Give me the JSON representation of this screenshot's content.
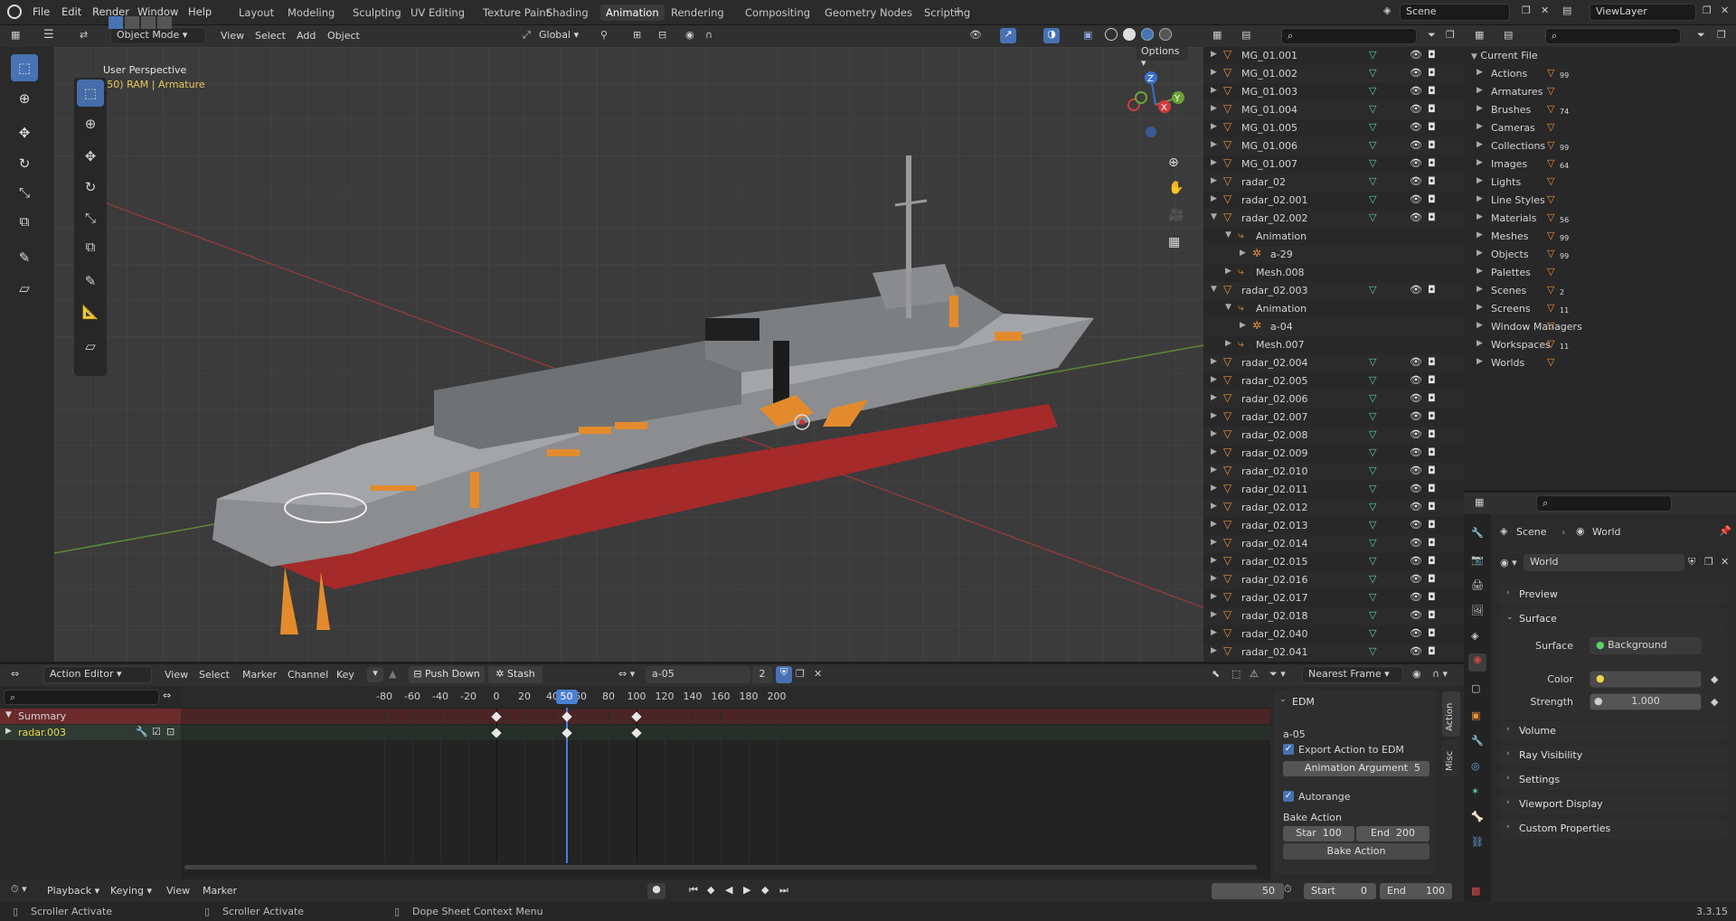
{
  "menu": {
    "file": "File",
    "edit": "Edit",
    "render": "Render",
    "window": "Window",
    "help": "Help"
  },
  "workspaces": [
    "Layout",
    "Modeling",
    "Sculpting",
    "UV Editing",
    "Texture Paint",
    "Shading",
    "Animation",
    "Rendering",
    "Compositing",
    "Geometry Nodes",
    "Scripting"
  ],
  "active_workspace": "Animation",
  "scene": {
    "name": "Scene",
    "view_layer": "ViewLayer"
  },
  "viewport": {
    "mode": "Object Mode",
    "view": "View",
    "select": "Select",
    "add": "Add",
    "object": "Object",
    "transform": "Global",
    "options": "Options",
    "title": "User Perspective",
    "subtitle": "(50) RAM | Armature"
  },
  "outliner": {
    "rows": [
      {
        "name": "MG_01.001",
        "indent": 0,
        "vis": true
      },
      {
        "name": "MG_01.002",
        "indent": 0,
        "vis": true
      },
      {
        "name": "MG_01.003",
        "indent": 0,
        "vis": true
      },
      {
        "name": "MG_01.004",
        "indent": 0,
        "vis": true
      },
      {
        "name": "MG_01.005",
        "indent": 0,
        "vis": true
      },
      {
        "name": "MG_01.006",
        "indent": 0,
        "vis": true
      },
      {
        "name": "MG_01.007",
        "indent": 0,
        "vis": true
      },
      {
        "name": "radar_02",
        "indent": 0,
        "vis": true
      },
      {
        "name": "radar_02.001",
        "indent": 0,
        "vis": true
      },
      {
        "name": "radar_02.002",
        "indent": 0,
        "vis": true,
        "open": true
      },
      {
        "name": "Animation",
        "indent": 1,
        "vis": false,
        "open": true
      },
      {
        "name": "a-29",
        "indent": 2,
        "vis": false
      },
      {
        "name": "Mesh.008",
        "indent": 1,
        "vis": false
      },
      {
        "name": "radar_02.003",
        "indent": 0,
        "vis": true,
        "open": true
      },
      {
        "name": "Animation",
        "indent": 1,
        "vis": false,
        "open": true
      },
      {
        "name": "a-04",
        "indent": 2,
        "vis": false
      },
      {
        "name": "Mesh.007",
        "indent": 1,
        "vis": false
      },
      {
        "name": "radar_02.004",
        "indent": 0,
        "vis": true
      },
      {
        "name": "radar_02.005",
        "indent": 0,
        "vis": true
      },
      {
        "name": "radar_02.006",
        "indent": 0,
        "vis": true
      },
      {
        "name": "radar_02.007",
        "indent": 0,
        "vis": true
      },
      {
        "name": "radar_02.008",
        "indent": 0,
        "vis": true
      },
      {
        "name": "radar_02.009",
        "indent": 0,
        "vis": true
      },
      {
        "name": "radar_02.010",
        "indent": 0,
        "vis": true
      },
      {
        "name": "radar_02.011",
        "indent": 0,
        "vis": true
      },
      {
        "name": "radar_02.012",
        "indent": 0,
        "vis": true
      },
      {
        "name": "radar_02.013",
        "indent": 0,
        "vis": true
      },
      {
        "name": "radar_02.014",
        "indent": 0,
        "vis": true
      },
      {
        "name": "radar_02.015",
        "indent": 0,
        "vis": true
      },
      {
        "name": "radar_02.016",
        "indent": 0,
        "vis": true
      },
      {
        "name": "radar_02.017",
        "indent": 0,
        "vis": true
      },
      {
        "name": "radar_02.018",
        "indent": 0,
        "vis": true
      },
      {
        "name": "radar_02.040",
        "indent": 0,
        "vis": true
      },
      {
        "name": "radar_02.041",
        "indent": 0,
        "vis": true
      }
    ]
  },
  "blend_file": {
    "root": "Current File",
    "items": [
      {
        "label": "Actions",
        "count": "99"
      },
      {
        "label": "Armatures",
        "count": ""
      },
      {
        "label": "Brushes",
        "count": "74"
      },
      {
        "label": "Cameras",
        "count": ""
      },
      {
        "label": "Collections",
        "count": "99"
      },
      {
        "label": "Images",
        "count": "64"
      },
      {
        "label": "Lights",
        "count": ""
      },
      {
        "label": "Line Styles",
        "count": ""
      },
      {
        "label": "Materials",
        "count": "56"
      },
      {
        "label": "Meshes",
        "count": "99"
      },
      {
        "label": "Objects",
        "count": "99"
      },
      {
        "label": "Palettes",
        "count": ""
      },
      {
        "label": "Scenes",
        "count": "2"
      },
      {
        "label": "Screens",
        "count": "11"
      },
      {
        "label": "Window Managers",
        "count": ""
      },
      {
        "label": "Workspaces",
        "count": "11"
      },
      {
        "label": "Worlds",
        "count": ""
      }
    ]
  },
  "properties": {
    "breadcrumb_scene": "Scene",
    "breadcrumb_world": "World",
    "world_name": "World",
    "sections": [
      "Preview",
      "Surface",
      "Volume",
      "Ray Visibility",
      "Settings",
      "Viewport Display",
      "Custom Properties"
    ],
    "surface_label": "Surface",
    "surface_value": "Background",
    "color_label": "Color",
    "strength_label": "Strength",
    "strength_value": "1.000"
  },
  "action_editor": {
    "mode": "Action Editor",
    "view": "View",
    "select": "Select",
    "marker": "Marker",
    "channel": "Channel",
    "key": "Key",
    "push_down": "Push Down",
    "stash": "Stash",
    "action": "a-05",
    "users": "2",
    "snap": "Nearest Frame",
    "channels": [
      {
        "name": "Summary"
      },
      {
        "name": "radar.003"
      }
    ],
    "ticks": [
      "-80",
      "-60",
      "-40",
      "-20",
      "0",
      "20",
      "40",
      "50",
      "60",
      "80",
      "100",
      "120",
      "140",
      "160",
      "180",
      "200"
    ],
    "current_frame": "50",
    "keyframe_frames": [
      0,
      50,
      100
    ]
  },
  "edm": {
    "tab_action": "Action",
    "tab_misc": "Misc",
    "header": "EDM",
    "action_name": "a-05",
    "export_label": "Export Action to EDM",
    "anim_arg_label": "Animation Argument",
    "anim_arg_value": "5",
    "autorange": "Autorange",
    "bake_label": "Bake Action",
    "start_label": "Star",
    "start_value": "100",
    "end_label": "End",
    "end_value": "200",
    "bake_button": "Bake Action"
  },
  "timeline": {
    "playback": "Playback",
    "keying": "Keying",
    "view": "View",
    "marker": "Marker",
    "frame": "50",
    "start_label": "Start",
    "start_value": "0",
    "end_label": "End",
    "end_value": "100"
  },
  "statusbar": {
    "left1": "Scroller Activate",
    "left2": "Scroller Activate",
    "left3": "Dope Sheet Context Menu",
    "version": "3.3.15"
  }
}
